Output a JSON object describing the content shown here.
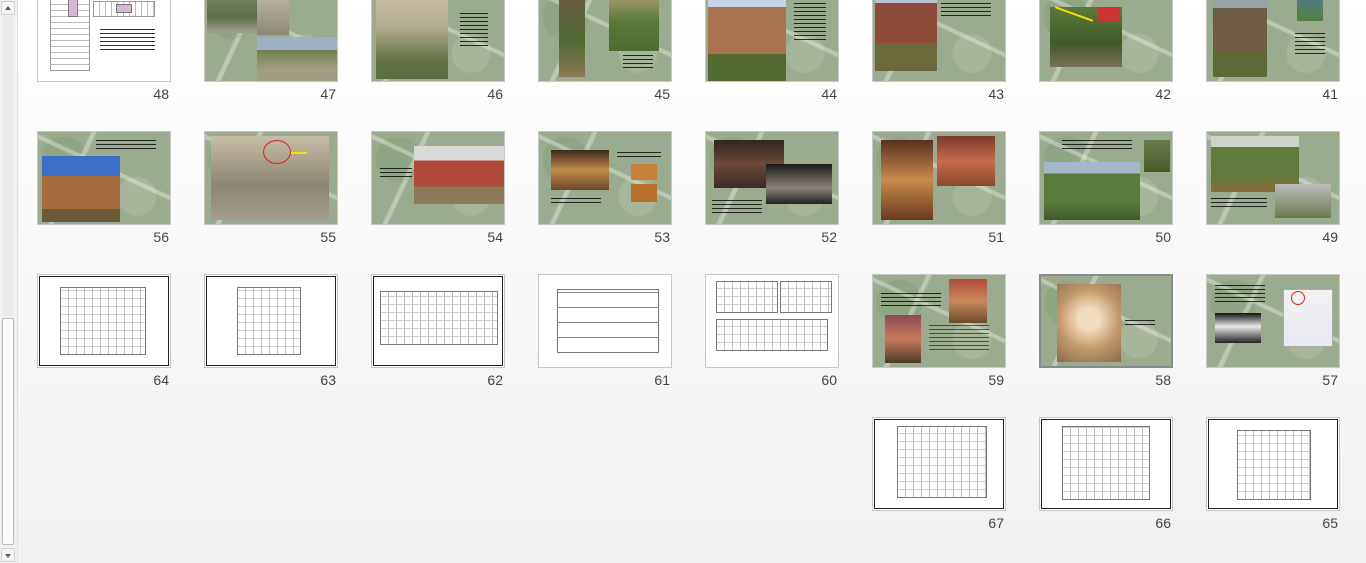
{
  "sorter": {
    "rows": [
      {
        "slides": [
          {
            "num": "48",
            "kind": "sketch"
          },
          {
            "num": "47",
            "kind": "photo"
          },
          {
            "num": "46",
            "kind": "photo"
          },
          {
            "num": "45",
            "kind": "photo"
          },
          {
            "num": "44",
            "kind": "photo"
          },
          {
            "num": "43",
            "kind": "photo"
          },
          {
            "num": "42",
            "kind": "photo"
          },
          {
            "num": "41",
            "kind": "photo"
          }
        ]
      },
      {
        "slides": [
          {
            "num": "56",
            "kind": "photo"
          },
          {
            "num": "55",
            "kind": "photo"
          },
          {
            "num": "54",
            "kind": "photo"
          },
          {
            "num": "53",
            "kind": "photo"
          },
          {
            "num": "52",
            "kind": "photo"
          },
          {
            "num": "51",
            "kind": "photo"
          },
          {
            "num": "50",
            "kind": "photo"
          },
          {
            "num": "49",
            "kind": "photo"
          }
        ]
      },
      {
        "slides": [
          {
            "num": "64",
            "kind": "plan"
          },
          {
            "num": "63",
            "kind": "plan"
          },
          {
            "num": "62",
            "kind": "plan"
          },
          {
            "num": "61",
            "kind": "section"
          },
          {
            "num": "60",
            "kind": "plan"
          },
          {
            "num": "59",
            "kind": "photo"
          },
          {
            "num": "58",
            "kind": "photo",
            "selected": true
          },
          {
            "num": "57",
            "kind": "photo"
          }
        ]
      },
      {
        "slides": [
          {
            "num": "67",
            "kind": "plan"
          },
          {
            "num": "66",
            "kind": "plan"
          },
          {
            "num": "65",
            "kind": "plan"
          }
        ]
      }
    ]
  },
  "colors": {
    "map_green": "#9aab8f",
    "selection_border": "#8a8a8a",
    "number_text": "#444444"
  }
}
